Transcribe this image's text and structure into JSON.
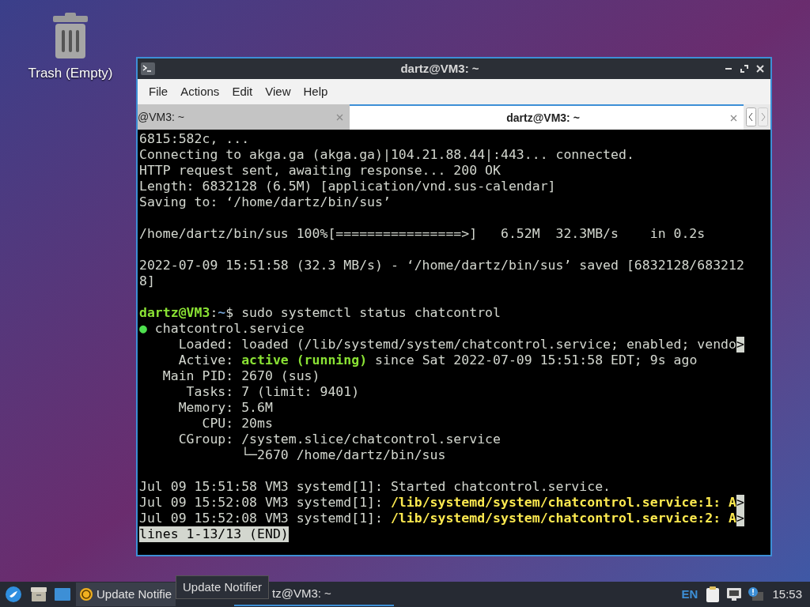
{
  "desktop": {
    "icons": [
      {
        "label": "Trash (Empty)"
      }
    ]
  },
  "window": {
    "title": "dartz@VM3: ~",
    "menu": [
      "File",
      "Actions",
      "Edit",
      "View",
      "Help"
    ],
    "tabs": [
      {
        "label": "@VM3: ~",
        "selected": false
      },
      {
        "label": "dartz@VM3: ~",
        "selected": true
      }
    ],
    "terminal": {
      "lines": [
        {
          "kind": "text",
          "segments": [
            {
              "text": "6815:582c, ...",
              "kind": "plain"
            }
          ]
        },
        {
          "kind": "text",
          "segments": [
            {
              "text": "Connecting to akga.ga (akga.ga)|104.21.88.44|:443... connected.",
              "kind": "plain"
            }
          ]
        },
        {
          "kind": "text",
          "segments": [
            {
              "text": "HTTP request sent, awaiting response... 200 OK",
              "kind": "plain"
            }
          ]
        },
        {
          "kind": "text",
          "segments": [
            {
              "text": "Length: 6832128 (6.5M) [application/vnd.sus-calendar]",
              "kind": "plain"
            }
          ]
        },
        {
          "kind": "text",
          "segments": [
            {
              "text": "Saving to: ‘/home/dartz/bin/sus’",
              "kind": "plain"
            }
          ]
        },
        {
          "kind": "blank"
        },
        {
          "kind": "text",
          "segments": [
            {
              "text": "/home/dartz/bin/sus 100%[================>]   6.52M  32.3MB/s    in 0.2s",
              "kind": "plain"
            }
          ]
        },
        {
          "kind": "blank"
        },
        {
          "kind": "text",
          "segments": [
            {
              "text": "2022-07-09 15:51:58 (32.3 MB/s) - ‘/home/dartz/bin/sus’ saved [6832128/683212",
              "kind": "plain"
            }
          ]
        },
        {
          "kind": "text",
          "segments": [
            {
              "text": "8]",
              "kind": "plain"
            }
          ]
        },
        {
          "kind": "blank"
        },
        {
          "kind": "text",
          "segments": [
            {
              "text": "dartz@VM3",
              "kind": "user"
            },
            {
              "text": ":",
              "kind": "plain"
            },
            {
              "text": "~",
              "kind": "dir"
            },
            {
              "text": "$ sudo systemctl status chatcontrol",
              "kind": "plain"
            }
          ]
        },
        {
          "kind": "text",
          "segments": [
            {
              "text": "●",
              "kind": "dot"
            },
            {
              "text": " chatcontrol.service",
              "kind": "plain"
            }
          ]
        },
        {
          "kind": "text",
          "segments": [
            {
              "text": "     Loaded: loaded (/lib/systemd/system/chatcontrol.service; enabled; vendo",
              "kind": "plain"
            },
            {
              "text": ">",
              "kind": "marker"
            }
          ]
        },
        {
          "kind": "text",
          "segments": [
            {
              "text": "     Active: ",
              "kind": "plain"
            },
            {
              "text": "active (running)",
              "kind": "active"
            },
            {
              "text": " since Sat 2022-07-09 15:51:58 EDT; 9s ago",
              "kind": "plain"
            }
          ]
        },
        {
          "kind": "text",
          "segments": [
            {
              "text": "   Main PID: 2670 (sus)",
              "kind": "plain"
            }
          ]
        },
        {
          "kind": "text",
          "segments": [
            {
              "text": "      Tasks: 7 (limit: 9401)",
              "kind": "plain"
            }
          ]
        },
        {
          "kind": "text",
          "segments": [
            {
              "text": "     Memory: 5.6M",
              "kind": "plain"
            }
          ]
        },
        {
          "kind": "text",
          "segments": [
            {
              "text": "        CPU: 20ms",
              "kind": "plain"
            }
          ]
        },
        {
          "kind": "text",
          "segments": [
            {
              "text": "     CGroup: /system.slice/chatcontrol.service",
              "kind": "plain"
            }
          ]
        },
        {
          "kind": "text",
          "segments": [
            {
              "text": "             └─2670 /home/dartz/bin/sus",
              "kind": "plain"
            }
          ]
        },
        {
          "kind": "blank"
        },
        {
          "kind": "text",
          "segments": [
            {
              "text": "Jul 09 15:51:58 VM3 systemd[1]: Started chatcontrol.service.",
              "kind": "plain"
            }
          ]
        },
        {
          "kind": "text",
          "segments": [
            {
              "text": "Jul 09 15:52:08 VM3 systemd[1]: ",
              "kind": "plain"
            },
            {
              "text": "/lib/systemd/system/chatcontrol.service:1: A",
              "kind": "warn"
            },
            {
              "text": ">",
              "kind": "marker"
            }
          ]
        },
        {
          "kind": "text",
          "segments": [
            {
              "text": "Jul 09 15:52:08 VM3 systemd[1]: ",
              "kind": "plain"
            },
            {
              "text": "/lib/systemd/system/chatcontrol.service:2: A",
              "kind": "warn"
            },
            {
              "text": ">",
              "kind": "marker"
            }
          ]
        },
        {
          "kind": "text",
          "segments": [
            {
              "text": "lines 1-13/13 (END)",
              "kind": "status"
            }
          ]
        }
      ]
    }
  },
  "taskbar": {
    "tasks": [
      {
        "label": "Update Notifie",
        "selected": false
      },
      {
        "label": "tz@VM3: ~",
        "selected": true
      }
    ],
    "tooltip": "Update Notifier",
    "language": "EN",
    "clock": "15:53"
  }
}
